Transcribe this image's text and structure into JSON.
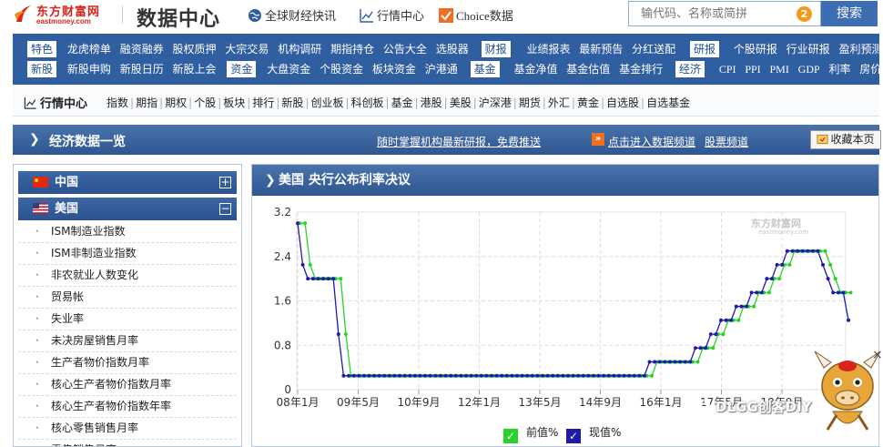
{
  "header": {
    "logo_name": "东方财富网",
    "logo_sub": "eastmoney.com",
    "site_title": "数据中心",
    "links": [
      "全球财经快讯",
      "行情中心",
      "Choice数据"
    ],
    "search_placeholder": "输代码、名称或简拼",
    "search_badge": "2",
    "search_button": "搜索"
  },
  "nav": {
    "row1": [
      {
        "cat": "特色",
        "items": [
          "龙虎榜单",
          "融资融券",
          "股权质押",
          "大宗交易",
          "机构调研",
          "期指持仓",
          "公告大全",
          "选股器"
        ]
      },
      {
        "cat": "财报",
        "items": [
          "业绩报表",
          "最新预告",
          "分红送配"
        ]
      },
      {
        "cat": "研报",
        "items": [
          "个股研报",
          "行业研报",
          "盈利预测"
        ]
      }
    ],
    "row2": [
      {
        "cat": "新股",
        "items": [
          "新股申购",
          "新股日历",
          "新股上会"
        ]
      },
      {
        "cat": "资金",
        "items": [
          "大盘资金",
          "个股资金",
          "板块资金",
          "沪港通"
        ]
      },
      {
        "cat": "基金",
        "items": [
          "基金净值",
          "基金估值",
          "基金排行"
        ]
      },
      {
        "cat": "经济",
        "items": [
          "CPI",
          "PPI",
          "PMI",
          "GDP",
          "利率",
          "房价"
        ]
      }
    ]
  },
  "subnav": {
    "home": "行情中心",
    "items": [
      "指数",
      "期指",
      "期权",
      "个股",
      "板块",
      "排行",
      "新股",
      "创业板",
      "科创板",
      "基金",
      "港股",
      "美股",
      "沪深港",
      "期货",
      "外汇",
      "黄金",
      "自选股",
      "自选基金"
    ]
  },
  "pagebar": {
    "title": "经济数据一览",
    "promo_link": "随时掌握机构最新研报，免费推送",
    "data_channel_link": "点击进入数据频道",
    "stock_channel_link": "股票频道",
    "collect_button": "收藏本页"
  },
  "sidebar": {
    "countries": [
      {
        "name": "中国",
        "expanded": false,
        "toggle": "+"
      },
      {
        "name": "美国",
        "expanded": true,
        "toggle": "−"
      }
    ],
    "items": [
      "ISM制造业指数",
      "ISM非制造业指数",
      "非农就业人数变化",
      "贸易帐",
      "失业率",
      "未决房屋销售月率",
      "生产者物价指数月率",
      "核心生产者物价指数月率",
      "核心生产者物价指数年率",
      "核心零售销售月率",
      "零售销售月率"
    ]
  },
  "chart_panel": {
    "title": "美国  央行公布利率决议",
    "watermark_name": "东方财富网",
    "watermark_sub": "eastmoney.com"
  },
  "chart_data": {
    "type": "line",
    "yticks": [
      "0",
      "0.8",
      "1.6",
      "2.4",
      "3.2"
    ],
    "ylim": [
      0,
      3.2
    ],
    "xticks": [
      "08年1月",
      "09年5月",
      "10年9月",
      "12年1月",
      "13年5月",
      "14年9月",
      "16年1月",
      "17年5月",
      "18年9月"
    ],
    "grid": true,
    "legend_position": "bottom",
    "series": [
      {
        "name": "前值%",
        "color": "#2ad12a",
        "lag": 1
      },
      {
        "name": "现值%",
        "color": "#1c1ca8",
        "lag": 0
      }
    ],
    "current_values": [
      3.0,
      2.25,
      2.0,
      2.0,
      2.0,
      2.0,
      2.0,
      2.0,
      1.0,
      0.25,
      0.25,
      0.25,
      0.25,
      0.25,
      0.25,
      0.25,
      0.25,
      0.25,
      0.25,
      0.25,
      0.25,
      0.25,
      0.25,
      0.25,
      0.25,
      0.25,
      0.25,
      0.25,
      0.25,
      0.25,
      0.25,
      0.25,
      0.25,
      0.25,
      0.25,
      0.25,
      0.25,
      0.25,
      0.25,
      0.25,
      0.25,
      0.25,
      0.25,
      0.25,
      0.25,
      0.25,
      0.25,
      0.25,
      0.25,
      0.25,
      0.25,
      0.25,
      0.25,
      0.25,
      0.25,
      0.25,
      0.25,
      0.25,
      0.25,
      0.25,
      0.25,
      0.25,
      0.25,
      0.25,
      0.25,
      0.25,
      0.25,
      0.25,
      0.25,
      0.5,
      0.5,
      0.5,
      0.5,
      0.5,
      0.5,
      0.5,
      0.5,
      0.5,
      0.75,
      0.75,
      0.75,
      1.0,
      1.0,
      1.25,
      1.25,
      1.25,
      1.5,
      1.5,
      1.5,
      1.75,
      1.75,
      1.75,
      2.0,
      2.0,
      2.25,
      2.25,
      2.5,
      2.5,
      2.5,
      2.5,
      2.5,
      2.5,
      2.5,
      2.25,
      2.0,
      1.75,
      1.75,
      1.75,
      1.25
    ],
    "previous_values": [
      3.0,
      3.0,
      2.25,
      2.0,
      2.0,
      2.0,
      2.0,
      2.0,
      2.0,
      1.0,
      0.25,
      0.25,
      0.25,
      0.25,
      0.25,
      0.25,
      0.25,
      0.25,
      0.25,
      0.25,
      0.25,
      0.25,
      0.25,
      0.25,
      0.25,
      0.25,
      0.25,
      0.25,
      0.25,
      0.25,
      0.25,
      0.25,
      0.25,
      0.25,
      0.25,
      0.25,
      0.25,
      0.25,
      0.25,
      0.25,
      0.25,
      0.25,
      0.25,
      0.25,
      0.25,
      0.25,
      0.25,
      0.25,
      0.25,
      0.25,
      0.25,
      0.25,
      0.25,
      0.25,
      0.25,
      0.25,
      0.25,
      0.25,
      0.25,
      0.25,
      0.25,
      0.25,
      0.25,
      0.25,
      0.25,
      0.25,
      0.25,
      0.25,
      0.25,
      0.25,
      0.5,
      0.5,
      0.5,
      0.5,
      0.5,
      0.5,
      0.5,
      0.5,
      0.5,
      0.75,
      0.75,
      0.75,
      1.0,
      1.0,
      1.25,
      1.25,
      1.25,
      1.5,
      1.5,
      1.5,
      1.75,
      1.75,
      1.75,
      2.0,
      2.0,
      2.25,
      2.25,
      2.5,
      2.5,
      2.5,
      2.5,
      2.5,
      2.5,
      2.5,
      2.25,
      2.0,
      1.75,
      1.75,
      1.75
    ]
  },
  "overlay": {
    "watermark_text": "DLGG创客DIY"
  },
  "colors": {
    "brand_red": "#d9241c",
    "nav_blue": "#2f5ea1",
    "grid": "#dddddd"
  }
}
